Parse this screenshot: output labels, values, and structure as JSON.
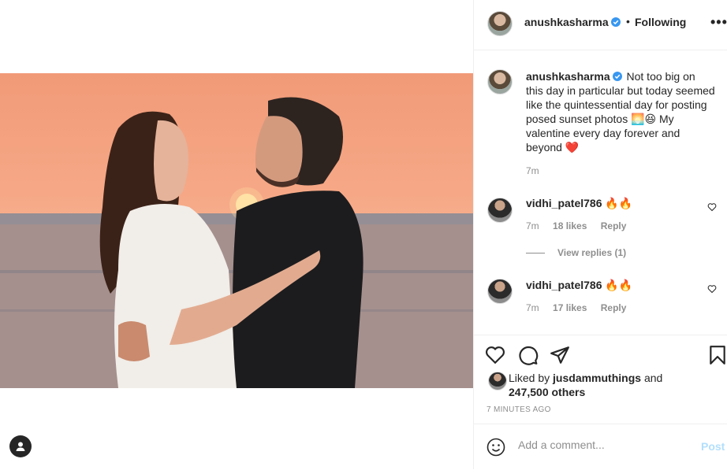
{
  "post": {
    "username": "anushkasharma",
    "follow_separator": "•",
    "follow_status": "Following",
    "more_label": "•••",
    "caption": "Not too big on this day in particular but today seemed like the quintessential day for posting posed sunset photos 🌅😆 My valentine every day forever and beyond ❤️",
    "caption_time": "7m"
  },
  "comments": [
    {
      "username": "vidhi_patel786",
      "text": "🔥🔥",
      "time": "7m",
      "likes": "18 likes",
      "reply": "Reply",
      "view_replies": "View replies (1)"
    },
    {
      "username": "vidhi_patel786",
      "text": "🔥🔥",
      "time": "7m",
      "likes": "17 likes",
      "reply": "Reply"
    }
  ],
  "likes": {
    "prefix": "Liked by",
    "user": "jusdammuthings",
    "and": "and",
    "others": "247,500 others"
  },
  "timestamp": "7 MINUTES AGO",
  "add_comment": {
    "placeholder": "Add a comment...",
    "post_label": "Post"
  },
  "icons": [
    "heart-icon",
    "comment-icon",
    "share-icon",
    "bookmark-icon",
    "emoji-icon",
    "user-tag-icon",
    "verified-icon"
  ],
  "colors": {
    "verified": "#3897f0",
    "link_disabled": "#b2dffc",
    "muted": "#8e8e8e"
  }
}
